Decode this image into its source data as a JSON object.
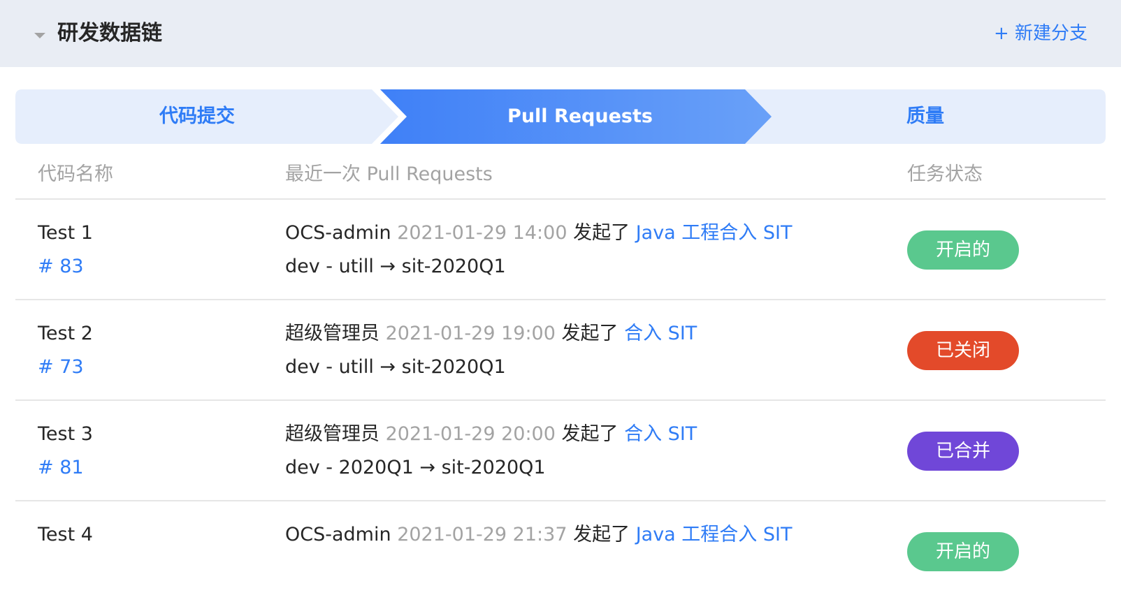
{
  "header": {
    "title": "研发数据链",
    "new_branch": "+ 新建分支"
  },
  "steps": [
    {
      "label": "代码提交"
    },
    {
      "label": "Pull Requests"
    },
    {
      "label": "质量"
    }
  ],
  "columns": {
    "name": "代码名称",
    "latest_pr": "最近一次 Pull Requests",
    "status": "任务状态"
  },
  "rows": [
    {
      "name": "Test 1",
      "id": "# 83",
      "author": "OCS-admin",
      "time": "2021-01-29 14:00",
      "verb": "发起了",
      "pr_title": "Java 工程合入 SIT",
      "branch": "dev - utill → sit-2020Q1",
      "status": "开启的",
      "status_color": "#5ac88e"
    },
    {
      "name": "Test 2",
      "id": "# 73",
      "author": "超级管理员",
      "time": "2021-01-29 19:00",
      "verb": "发起了",
      "pr_title": "合入 SIT",
      "branch": "dev - utill → sit-2020Q1",
      "status": "已关闭",
      "status_color": "#e34a2a"
    },
    {
      "name": "Test 3",
      "id": "# 81",
      "author": "超级管理员",
      "time": "2021-01-29 20:00",
      "verb": "发起了",
      "pr_title": "合入 SIT",
      "branch": "dev - 2020Q1 → sit-2020Q1",
      "status": "已合并",
      "status_color": "#7047d8"
    },
    {
      "name": "Test 4",
      "id": "",
      "author": "OCS-admin",
      "time": "2021-01-29 21:37",
      "verb": "发起了",
      "pr_title": "Java 工程合入 SIT",
      "branch": "",
      "status": "开启的",
      "status_color": "#5ac88e"
    }
  ],
  "colors": {
    "accent": "#2f7cf6",
    "step_active": "#4a86f7",
    "step_inactive": "#e6eefc"
  }
}
